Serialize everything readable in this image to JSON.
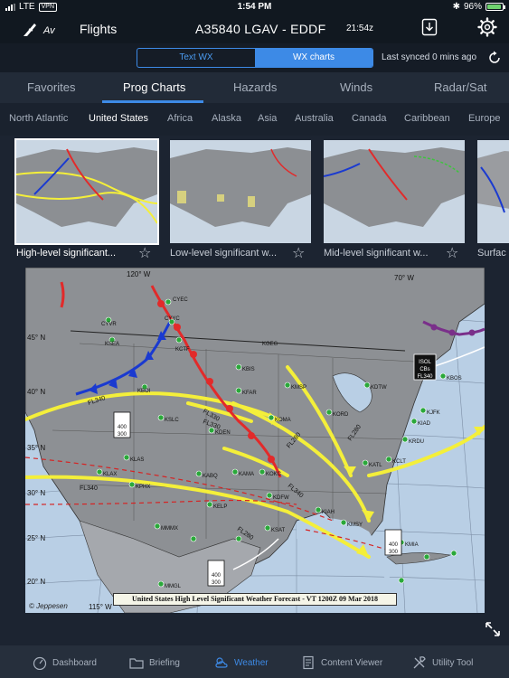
{
  "status_bar": {
    "carrier": "LTE",
    "vpn": "VPN",
    "time": "1:54 PM",
    "battery_percent": "96%",
    "battery_level": 0.96
  },
  "top_nav": {
    "logo_text": "Av",
    "flights_label": "Flights",
    "route": "A35840 LGAV - EDDF",
    "zulu_time": "21:54z"
  },
  "wx_toggle": {
    "text_wx_label": "Text WX",
    "wx_charts_label": "WX charts",
    "last_synced": "Last synced 0 mins ago"
  },
  "tabs": [
    {
      "label": "Favorites"
    },
    {
      "label": "Prog Charts"
    },
    {
      "label": "Hazards"
    },
    {
      "label": "Winds"
    },
    {
      "label": "Radar/Sat"
    }
  ],
  "regions": [
    {
      "label": "North Atlantic"
    },
    {
      "label": "United States"
    },
    {
      "label": "Africa"
    },
    {
      "label": "Alaska"
    },
    {
      "label": "Asia"
    },
    {
      "label": "Australia"
    },
    {
      "label": "Canada"
    },
    {
      "label": "Caribbean"
    },
    {
      "label": "Europe"
    }
  ],
  "thumbnails": [
    {
      "label": "High-level significant..."
    },
    {
      "label": "Low-level significant w..."
    },
    {
      "label": "Mid-level significant w..."
    },
    {
      "label": "Surfac"
    }
  ],
  "map": {
    "caption": "United States High Level Significant Weather Forecast - VT 1200Z 09 Mar 2018",
    "copyright": "© Jeppesen",
    "longitude_labels": [
      "120° W",
      "70° W",
      "115° W"
    ],
    "latitude_labels": [
      "45° N",
      "40° N",
      "35° N",
      "30° N",
      "25° N",
      "20° N"
    ],
    "stations": [
      "CYEC",
      "CYVR",
      "CYYC",
      "KSEA",
      "KCTF",
      "KBOI",
      "KGEG",
      "KBIS",
      "KFAR",
      "KMSP",
      "KSLC",
      "KDEN",
      "KOMA",
      "KLAS",
      "KLAX",
      "KABQ",
      "KAMA",
      "KOKC",
      "KDFW",
      "KPHX",
      "KELP",
      "KSAT",
      "KIAH",
      "KMSY",
      "KATL",
      "KCLT",
      "KRDU",
      "KORD",
      "KDTW",
      "KBOS",
      "KJFK",
      "KIAD",
      "KMIA",
      "MMMX",
      "MMGL"
    ],
    "flight_levels": [
      "FL340",
      "FL330",
      "FL280",
      "FL330",
      "FL340",
      "FL280",
      "FL340",
      "FL280"
    ],
    "cloud_boxes": [
      {
        "top": "400",
        "bottom": "300"
      },
      {
        "top": "400",
        "bottom": "300"
      },
      {
        "top": "400",
        "bottom": "300"
      }
    ],
    "isol_box": {
      "line1": "ISOL",
      "line2": "CBs",
      "line3": "FL340"
    }
  },
  "bottom_nav": [
    {
      "label": "Dashboard"
    },
    {
      "label": "Briefing"
    },
    {
      "label": "Weather"
    },
    {
      "label": "Content Viewer"
    },
    {
      "label": "Utility Tool"
    }
  ],
  "colors": {
    "accent": "#3d8ae6",
    "jetstream": "#f4ef3a",
    "cold_front": "#1a3ad0",
    "warm_front": "#e22a2a"
  }
}
